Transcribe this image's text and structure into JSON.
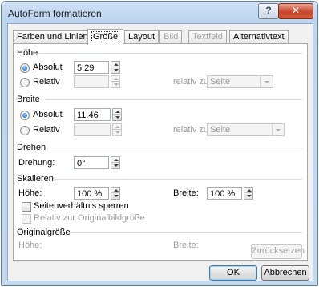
{
  "window": {
    "title": "AutoForm formatieren"
  },
  "tabs": [
    {
      "label": "Farben und Linien"
    },
    {
      "label": "Größe"
    },
    {
      "label": "Layout"
    },
    {
      "label": "Bild"
    },
    {
      "label": "Textfeld"
    },
    {
      "label": "Alternativtext"
    }
  ],
  "hoehe": {
    "section": "Höhe",
    "absolut_label": "Absolut",
    "absolut_value": "5.29 cm",
    "relativ_label": "Relativ",
    "relativ_zu_label": "relativ zu",
    "relativ_zu_value": "Seite"
  },
  "breite": {
    "section": "Breite",
    "absolut_label": "Absolut",
    "absolut_value": "11.46 cm",
    "relativ_label": "Relativ",
    "relativ_zu_label": "relativ zu",
    "relativ_zu_value": "Seite"
  },
  "drehen": {
    "section": "Drehen",
    "drehung_label": "Drehung:",
    "drehung_value": "0°"
  },
  "skalieren": {
    "section": "Skalieren",
    "hoehe_label": "Höhe:",
    "hoehe_value": "100 %",
    "breite_label": "Breite:",
    "breite_value": "100 %",
    "lock_label": "Seitenverhältnis sperren",
    "relative_original_label": "Relativ zur Originalbildgröße"
  },
  "original": {
    "section": "Originalgröße",
    "hoehe_label": "Höhe:",
    "breite_label": "Breite:",
    "reset_label": "Zurücksetzen"
  },
  "footer": {
    "ok_label": "OK",
    "cancel_label": "Abbrechen"
  }
}
